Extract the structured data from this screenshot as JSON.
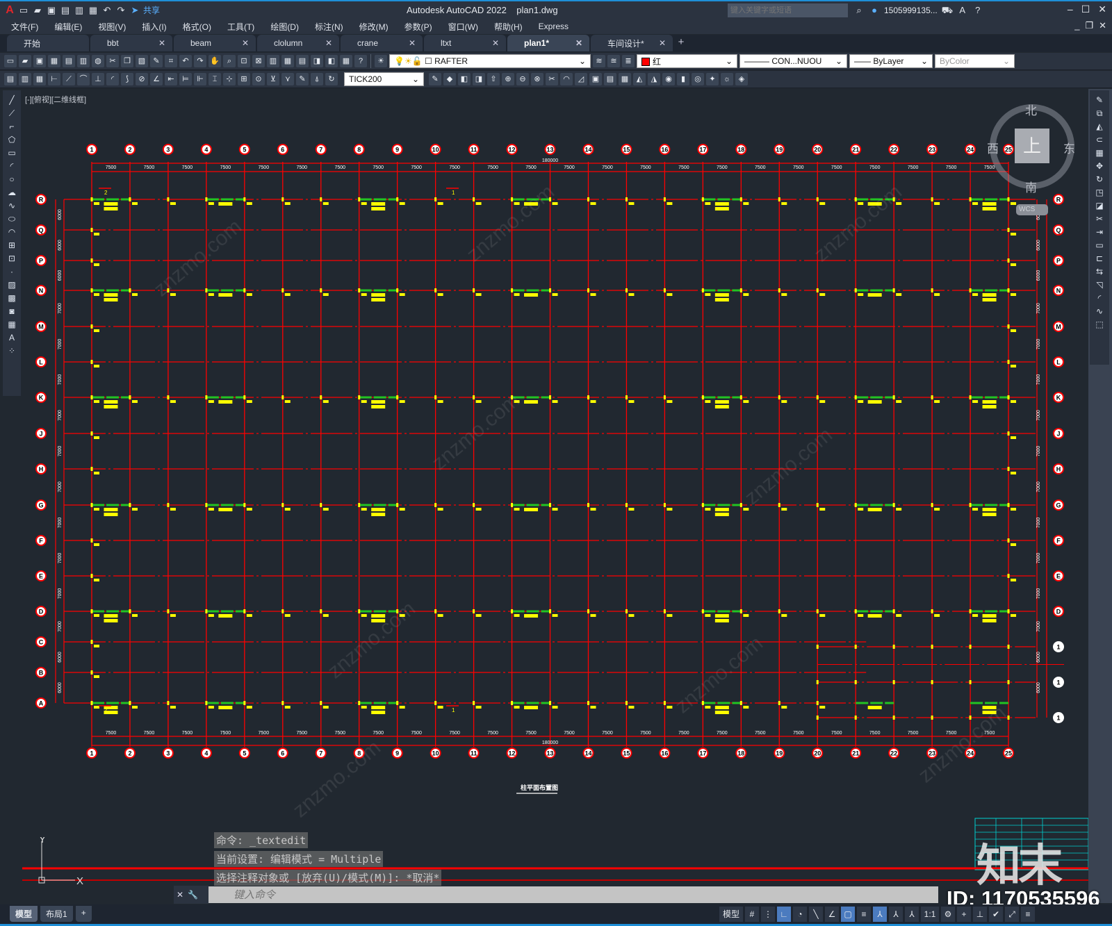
{
  "titlebar": {
    "app_title": "Autodesk AutoCAD 2022",
    "file": "plan1.dwg",
    "share_label": "共享",
    "search_placeholder": "键入关键字或短语",
    "user": "1505999135...",
    "logo": "A"
  },
  "menu": [
    "文件(F)",
    "编辑(E)",
    "视图(V)",
    "插入(I)",
    "格式(O)",
    "工具(T)",
    "绘图(D)",
    "标注(N)",
    "修改(M)",
    "参数(P)",
    "窗口(W)",
    "帮助(H)",
    "Express"
  ],
  "tabs": [
    {
      "label": "开始",
      "closable": false
    },
    {
      "label": "bbt",
      "closable": true
    },
    {
      "label": "beam",
      "closable": true
    },
    {
      "label": "clolumn",
      "closable": true
    },
    {
      "label": "crane",
      "closable": true
    },
    {
      "label": "ltxt",
      "closable": true
    },
    {
      "label": "plan1*",
      "closable": true,
      "active": true
    },
    {
      "label": "车间设计*",
      "closable": true
    }
  ],
  "toolbar": {
    "layer": "RAFTER",
    "color": "红",
    "color_hex": "#ff0000",
    "linetype": "CON...NUOU",
    "lineweight": "ByLayer",
    "plotstyle": "ByColor",
    "dimstyle": "TICK200"
  },
  "viewport_label": "[-][俯视][二维线框]",
  "viewcube": {
    "north": "北",
    "south": "南",
    "east": "东",
    "west": "西",
    "face": "上",
    "wcs": "WCS"
  },
  "drawing": {
    "columns": [
      "1",
      "2",
      "3",
      "4",
      "5",
      "6",
      "7",
      "8",
      "9",
      "10",
      "11",
      "12",
      "13",
      "14",
      "15",
      "16",
      "17",
      "18",
      "19",
      "20",
      "21",
      "22",
      "23",
      "24",
      "25"
    ],
    "rows": [
      "R",
      "Q",
      "P",
      "N",
      "M",
      "L",
      "K",
      "J",
      "H",
      "G",
      "F",
      "E",
      "D",
      "C",
      "B",
      "A"
    ],
    "bay_dim": "7500",
    "total_dim_top": "180000",
    "total_dim_bottom": "180000",
    "row_dims": [
      "6000",
      "6000",
      "6000",
      "7000",
      "7000",
      "7000",
      "7000",
      "7000",
      "7000",
      "7000",
      "7000",
      "7000",
      "7000",
      "6000",
      "6000"
    ],
    "right_extra_rows": [
      "1",
      "1",
      "1"
    ],
    "beam_rows": [
      "R",
      "N",
      "K",
      "G",
      "D",
      "A"
    ],
    "beam_bays": [
      [
        1,
        2
      ],
      [
        4,
        5
      ],
      [
        8,
        9
      ],
      [
        12,
        13
      ],
      [
        17,
        18
      ],
      [
        21,
        22
      ],
      [
        24,
        25
      ]
    ],
    "section_marks": [
      "2",
      "1",
      "2",
      "1"
    ],
    "title": "柱平面布置图",
    "colors": {
      "grid": "#ff0000",
      "beam": "#22c422",
      "label": "#ffff00",
      "background": "#212830"
    }
  },
  "command": {
    "history": [
      "命令: _textedit",
      "当前设置: 编辑模式 = Multiple",
      "选择注释对象或 [放弃(U)/模式(M)]: *取消*"
    ],
    "placeholder": "键入命令"
  },
  "ucs": {
    "x": "X",
    "y": "Y"
  },
  "status": {
    "layout_tabs": [
      "模型",
      "布局1"
    ],
    "model_label": "模型",
    "scale": "1:1"
  },
  "watermark": {
    "id": "ID: 1170535596",
    "logo": "知末",
    "site": "znzmo.com"
  }
}
